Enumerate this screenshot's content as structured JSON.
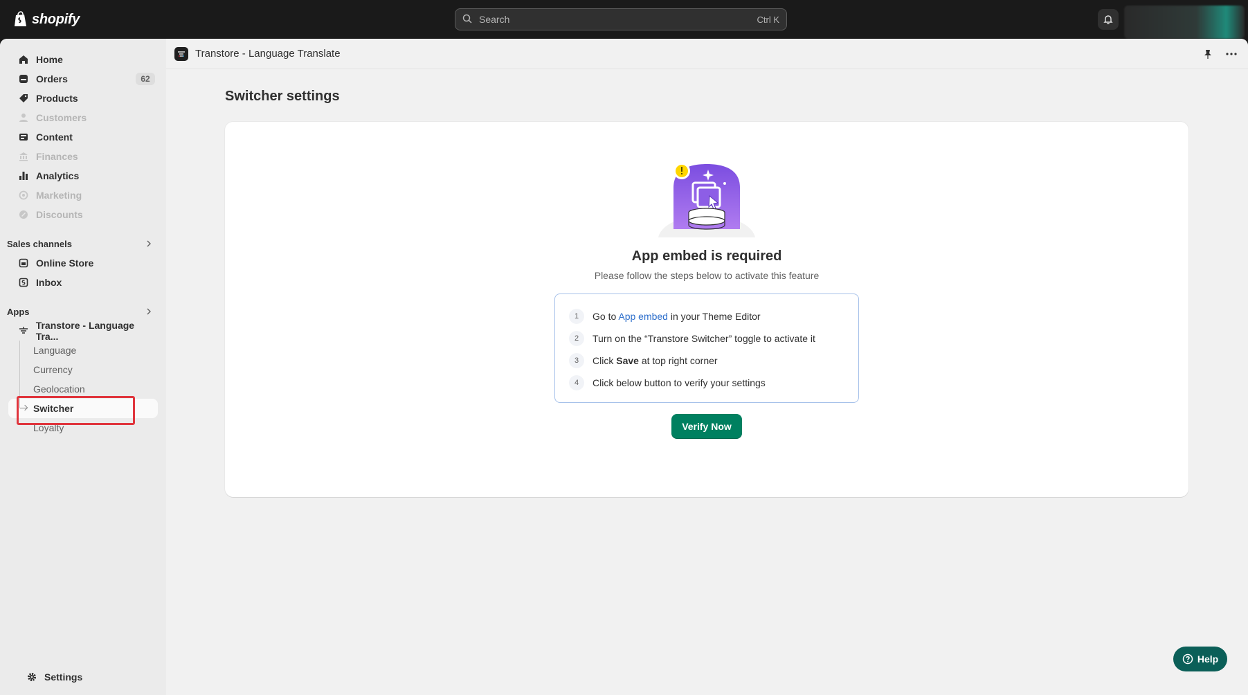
{
  "brand": {
    "name": "shopify",
    "accent": "#008060"
  },
  "search": {
    "placeholder": "Search",
    "shortcut": "Ctrl K"
  },
  "sidebar": {
    "items": [
      {
        "label": "Home",
        "icon": "home-icon",
        "enabled": true
      },
      {
        "label": "Orders",
        "icon": "orders-icon",
        "enabled": true,
        "badge": "62"
      },
      {
        "label": "Products",
        "icon": "tag-icon",
        "enabled": true
      },
      {
        "label": "Customers",
        "icon": "person-icon",
        "enabled": false
      },
      {
        "label": "Content",
        "icon": "content-icon",
        "enabled": true
      },
      {
        "label": "Finances",
        "icon": "bank-icon",
        "enabled": false
      },
      {
        "label": "Analytics",
        "icon": "bar-chart-icon",
        "enabled": true
      },
      {
        "label": "Marketing",
        "icon": "target-icon",
        "enabled": false
      },
      {
        "label": "Discounts",
        "icon": "discount-icon",
        "enabled": false
      }
    ],
    "sales_channels": {
      "label": "Sales channels",
      "items": [
        {
          "label": "Online Store",
          "icon": "store-icon"
        },
        {
          "label": "Inbox",
          "icon": "inbox-icon"
        }
      ]
    },
    "apps": {
      "label": "Apps",
      "app_name": "Transtore - Language Tra...",
      "sub_items": [
        "Language",
        "Currency",
        "Geolocation",
        "Switcher",
        "Loyalty"
      ],
      "active": "Switcher"
    },
    "settings_label": "Settings"
  },
  "app_header": {
    "title": "Transtore - Language Translate"
  },
  "page": {
    "title": "Switcher settings",
    "card_title": "App embed is required",
    "card_subtitle": "Please follow the steps below to activate this feature",
    "steps": [
      {
        "num": "1",
        "pre": "Go to ",
        "link": "App embed",
        "post": " in your Theme Editor"
      },
      {
        "num": "2",
        "text": "Turn on the “Transtore Switcher” toggle to activate it"
      },
      {
        "num": "3",
        "pre": "Click ",
        "bold": "Save",
        "post": " at top right corner"
      },
      {
        "num": "4",
        "text": "Click below button to verify your settings"
      }
    ],
    "verify_button": "Verify Now"
  },
  "help_button": "Help"
}
